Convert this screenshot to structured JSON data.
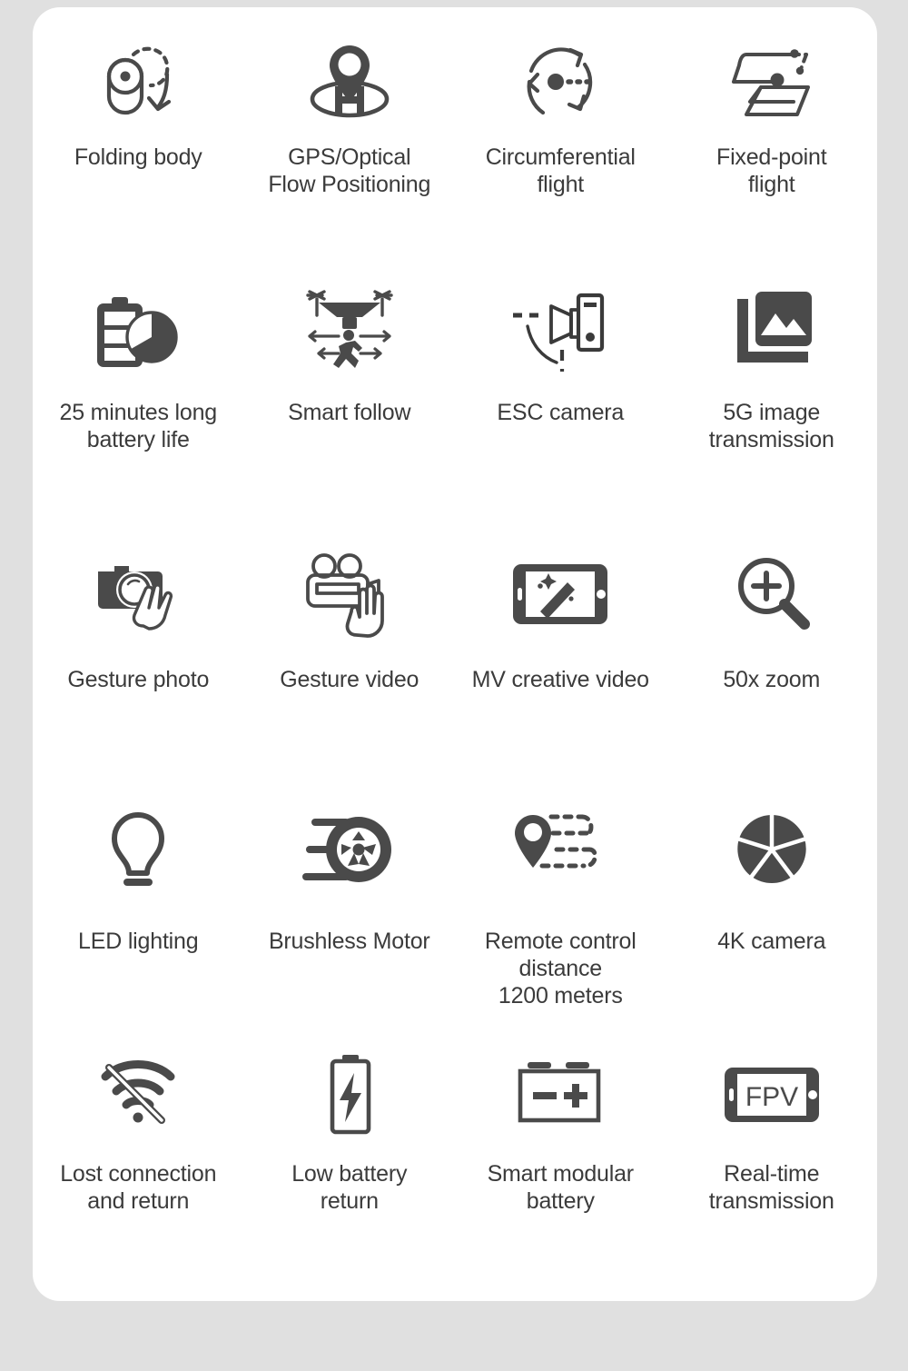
{
  "page": {
    "background_color": "#e0e0e0",
    "card_color": "#ffffff",
    "icon_color": "#4a4a4a",
    "text_color": "#3b3b3b"
  },
  "features": [
    {
      "icon": "folding-body-icon",
      "label": "Folding body"
    },
    {
      "icon": "gps-optical-flow-icon",
      "label": "GPS/Optical\nFlow Positioning"
    },
    {
      "icon": "circumferential-flight-icon",
      "label": "Circumferential\nflight"
    },
    {
      "icon": "fixed-point-flight-icon",
      "label": "Fixed-point\nflight"
    },
    {
      "icon": "battery-life-icon",
      "label": "25 minutes long\nbattery life"
    },
    {
      "icon": "smart-follow-icon",
      "label": "Smart follow"
    },
    {
      "icon": "esc-camera-icon",
      "label": "ESC camera"
    },
    {
      "icon": "image-transmission-icon",
      "label": "5G image\ntransmission"
    },
    {
      "icon": "gesture-photo-icon",
      "label": "Gesture photo"
    },
    {
      "icon": "gesture-video-icon",
      "label": "Gesture video"
    },
    {
      "icon": "mv-creative-video-icon",
      "label": "MV creative video"
    },
    {
      "icon": "zoom-icon",
      "label": "50x zoom"
    },
    {
      "icon": "led-lighting-icon",
      "label": "LED lighting"
    },
    {
      "icon": "brushless-motor-icon",
      "label": "Brushless Motor"
    },
    {
      "icon": "remote-control-distance-icon",
      "label": "Remote control\ndistance\n1200 meters"
    },
    {
      "icon": "4k-camera-icon",
      "label": "4K camera"
    },
    {
      "icon": "lost-connection-icon",
      "label": "Lost connection\nand return"
    },
    {
      "icon": "low-battery-return-icon",
      "label": "Low battery\nreturn"
    },
    {
      "icon": "smart-modular-battery-icon",
      "label": "Smart modular\nbattery"
    },
    {
      "icon": "fpv-realtime-icon",
      "label": "Real-time\ntransmission"
    }
  ]
}
